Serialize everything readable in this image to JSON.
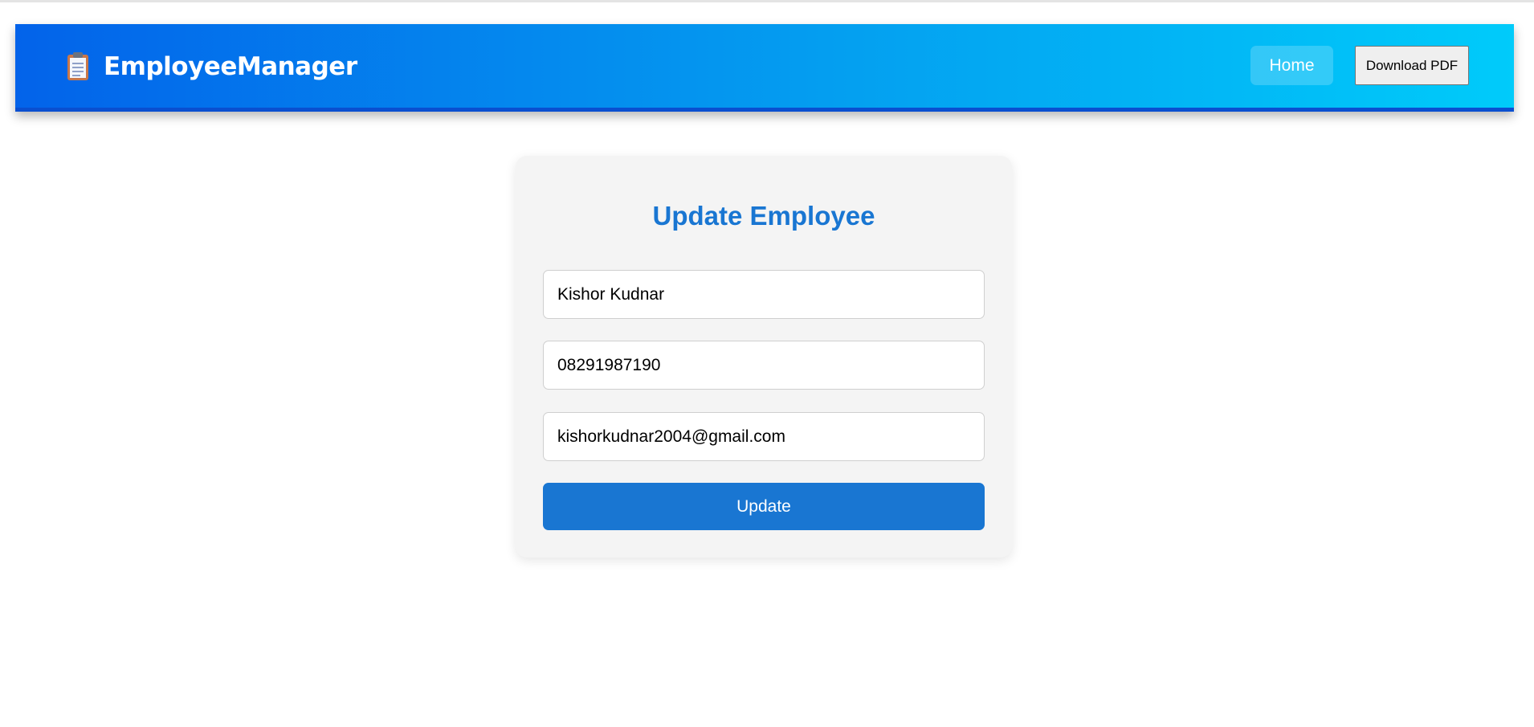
{
  "header": {
    "brand_icon": "clipboard-icon",
    "brand_name": "EmployeeManager",
    "nav": {
      "home_label": "Home",
      "download_pdf_label": "Download PDF"
    }
  },
  "form": {
    "title": "Update Employee",
    "name_value": "Kishor Kudnar",
    "phone_value": "08291987190",
    "email_value": "kishorkudnar2004@gmail.com",
    "submit_label": "Update"
  },
  "colors": {
    "header_gradient_start": "#0363ea",
    "header_gradient_end": "#00cbfa",
    "accent": "#1976d2",
    "card_background": "#f4f4f4"
  }
}
